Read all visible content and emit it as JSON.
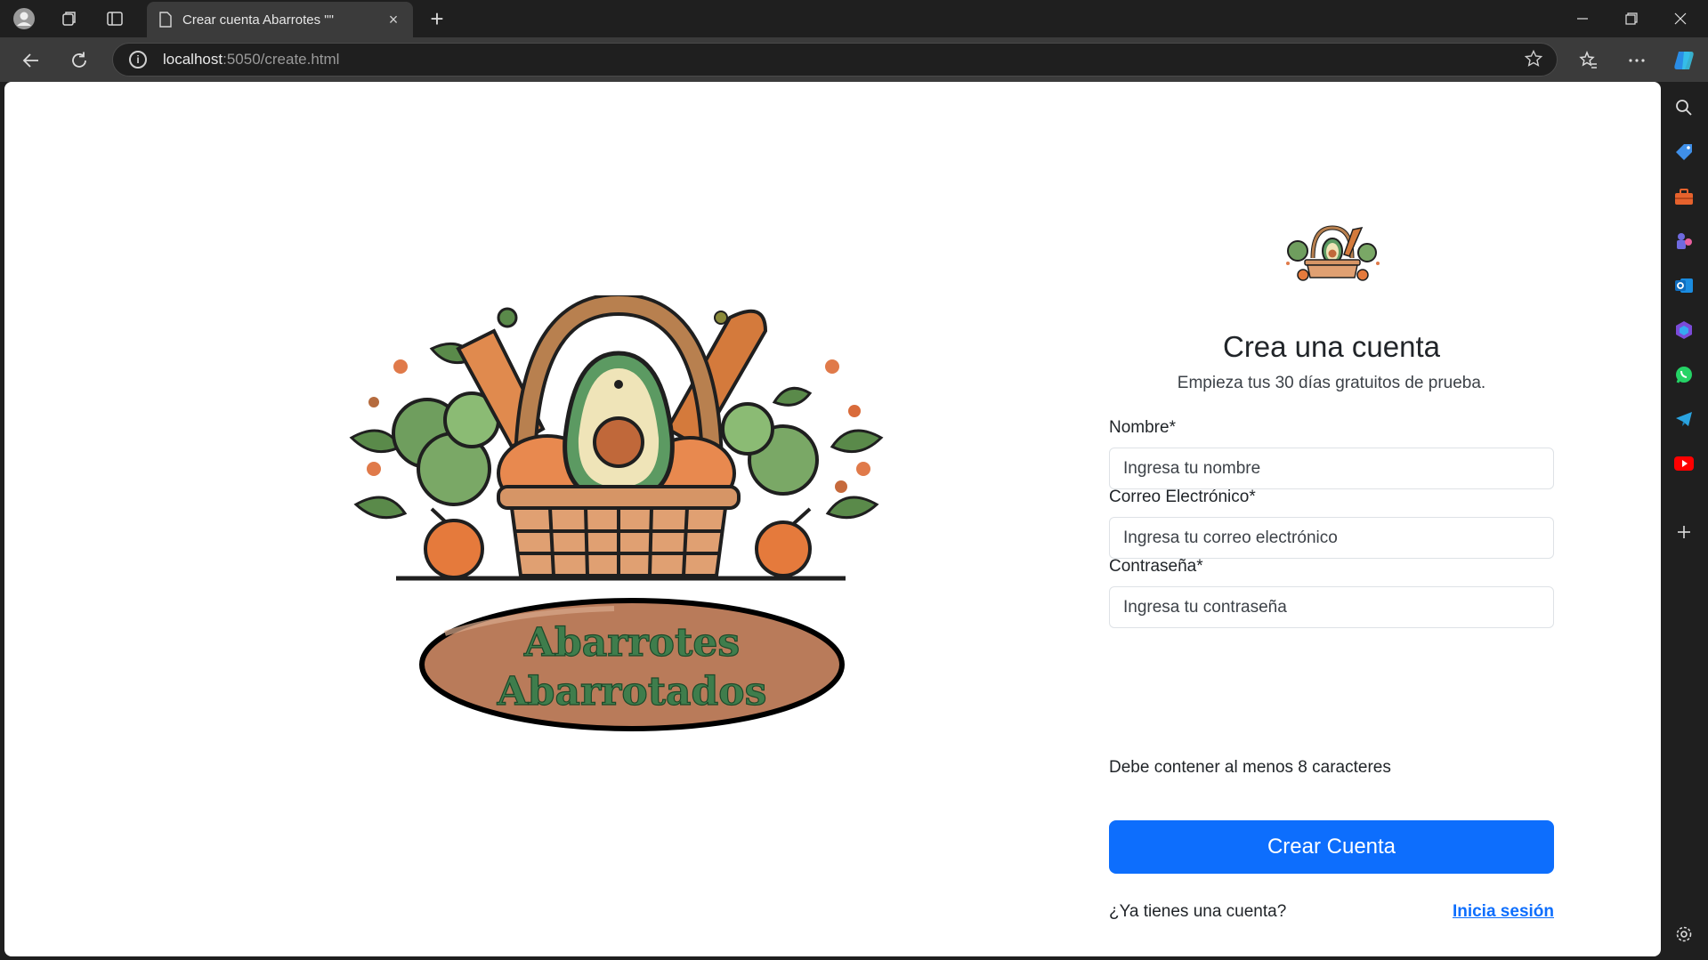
{
  "browser": {
    "tab_title": "Crear cuenta Abarrotes \"\"",
    "tab_close": "×",
    "new_tab": "+",
    "url_host": "localhost",
    "url_rest": ":5050/create.html",
    "info_glyph": "i"
  },
  "logo": {
    "line1": "Abarrotes",
    "line2": "Abarrotados"
  },
  "form": {
    "title": "Crea una cuenta",
    "subtitle": "Empieza tus 30 días gratuitos de prueba.",
    "name_label": "Nombre*",
    "name_placeholder": "Ingresa tu nombre",
    "email_label": "Correo Electrónico*",
    "email_placeholder": "Ingresa tu correo electrónico",
    "password_label": "Contraseña*",
    "password_placeholder": "Ingresa tu contraseña",
    "password_hint": "Debe contener al menos 8 caracteres",
    "submit_label": "Crear Cuenta",
    "login_prompt": "¿Ya tienes una cuenta?",
    "login_link": "Inicia sesión"
  },
  "colors": {
    "primary": "#0d6efd",
    "logo_green": "#3f7d4c",
    "logo_brown": "#b97b5a"
  }
}
